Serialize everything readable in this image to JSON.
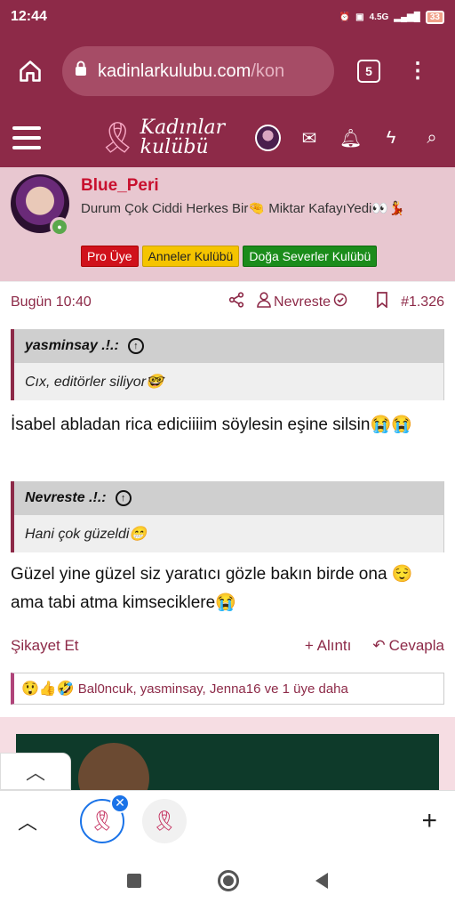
{
  "status": {
    "time": "12:44",
    "net": "4.5G",
    "battery": "33"
  },
  "browser": {
    "url_main": "kadinlarkulubu.com",
    "url_dim": "/kon",
    "tab_count": "5",
    "menu_glyph": "⋮"
  },
  "site": {
    "logo_line1": "Kadınlar",
    "logo_line2": "kulübü"
  },
  "user": {
    "name": "Blue_Peri",
    "status": "Durum Çok Ciddi Herkes Bir🤏 Miktar KafayıYedi👀💃",
    "badges": [
      "Pro Üye",
      "Anneler Kulübü",
      "Doğa Severler Kulübü"
    ]
  },
  "post": {
    "date": "Bugün 10:40",
    "author": "Nevreste",
    "number": "#1.326"
  },
  "quote1": {
    "author": "yasminsay .!.:",
    "text": "Cıx, editörler siliyor🤓"
  },
  "message1": "İsabel abladan rica ediciiiim söylesin eşine silsin😭😭",
  "quote2": {
    "author": "Nevreste .!.:",
    "text": "Hani çok güzeldi😁"
  },
  "message2": "Güzel yine güzel siz yaratıcı gözle bakın birde ona 😌 ama tabi atma kimseciklere😭",
  "actions": {
    "report": "Şikayet Et",
    "quote": "+ Alıntı",
    "reply": "Cevapla"
  },
  "reactions": {
    "emojis": "😲👍🤣",
    "text": "Bal0ncuk, yasminsay, Jenna16 ve 1 üye daha"
  },
  "colors": {
    "brand": "#8d2a48",
    "userbox": "#e8c7d0",
    "accent_blue": "#1a73e8"
  }
}
